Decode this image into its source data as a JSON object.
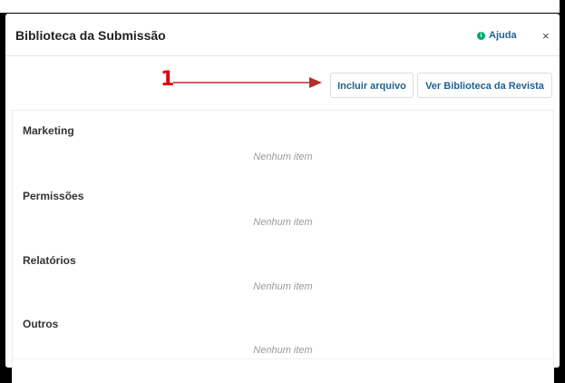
{
  "modal": {
    "title": "Biblioteca da Submissão",
    "help_label": "Ajuda",
    "close_label": "×"
  },
  "toolbar": {
    "upload_label": "Incluir arquivo",
    "journal_library_label": "Ver Biblioteca da Revista"
  },
  "annotation": {
    "number": "1",
    "color": "#e00000"
  },
  "sections": [
    {
      "name": "Marketing",
      "empty_text": "Nenhum item"
    },
    {
      "name": "Permissões",
      "empty_text": "Nenhum item"
    },
    {
      "name": "Relatórios",
      "empty_text": "Nenhum item"
    },
    {
      "name": "Outros",
      "empty_text": "Nenhum item"
    }
  ],
  "colors": {
    "link": "#1e6292",
    "help_icon": "#00a86b",
    "empty_text": "#9a9a9a"
  }
}
